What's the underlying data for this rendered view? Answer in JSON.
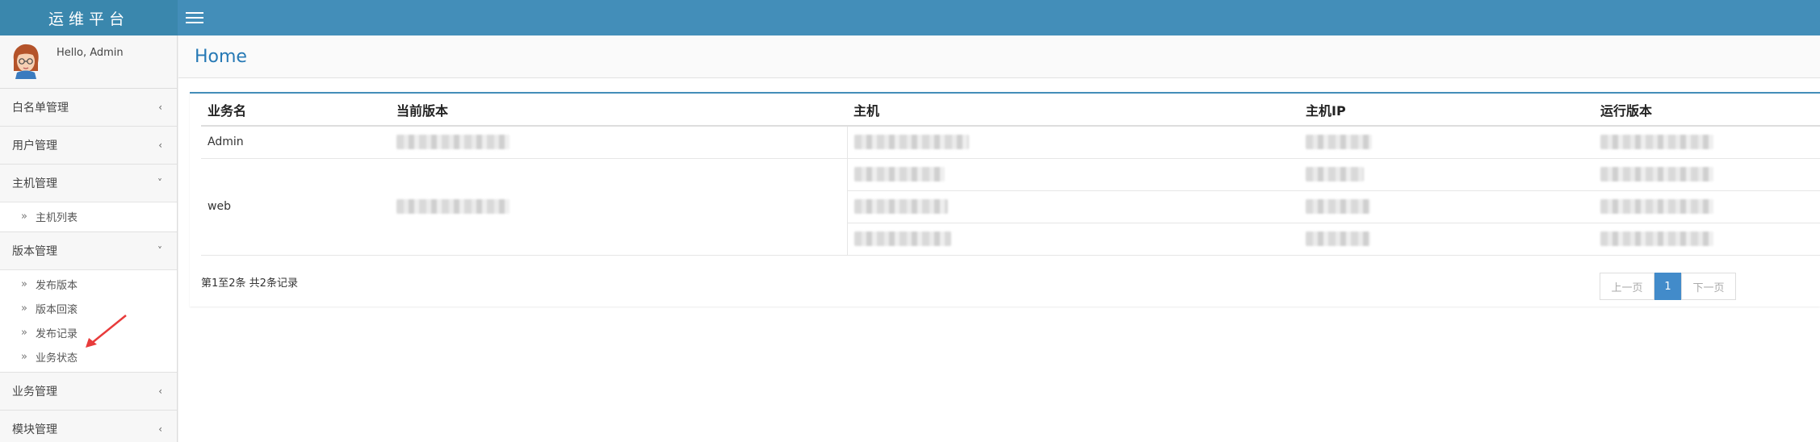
{
  "brand": "运维平台",
  "user": {
    "greeting": "Hello, Admin"
  },
  "sidebar": {
    "groups": [
      {
        "label": "白名单管理",
        "expanded": false,
        "items": []
      },
      {
        "label": "用户管理",
        "expanded": false,
        "items": []
      },
      {
        "label": "主机管理",
        "expanded": true,
        "items": [
          "主机列表"
        ]
      },
      {
        "label": "版本管理",
        "expanded": true,
        "items": [
          "发布版本",
          "版本回滚",
          "发布记录",
          "业务状态"
        ]
      },
      {
        "label": "业务管理",
        "expanded": false,
        "items": []
      },
      {
        "label": "模块管理",
        "expanded": false,
        "items": []
      }
    ]
  },
  "page": {
    "title": "Home"
  },
  "table": {
    "headers": [
      "业务名",
      "当前版本",
      "主机",
      "主机IP",
      "运行版本"
    ],
    "rows": [
      {
        "name": "Admin"
      },
      {
        "name": "web"
      }
    ]
  },
  "summary": "第1至2条 共2条记录",
  "pagination": {
    "prev": "上一页",
    "current": "1",
    "next": "下一页"
  },
  "colors": {
    "accent": "#438eb9",
    "title": "#2679b5",
    "annotation_arrow": "#e83b3b"
  }
}
